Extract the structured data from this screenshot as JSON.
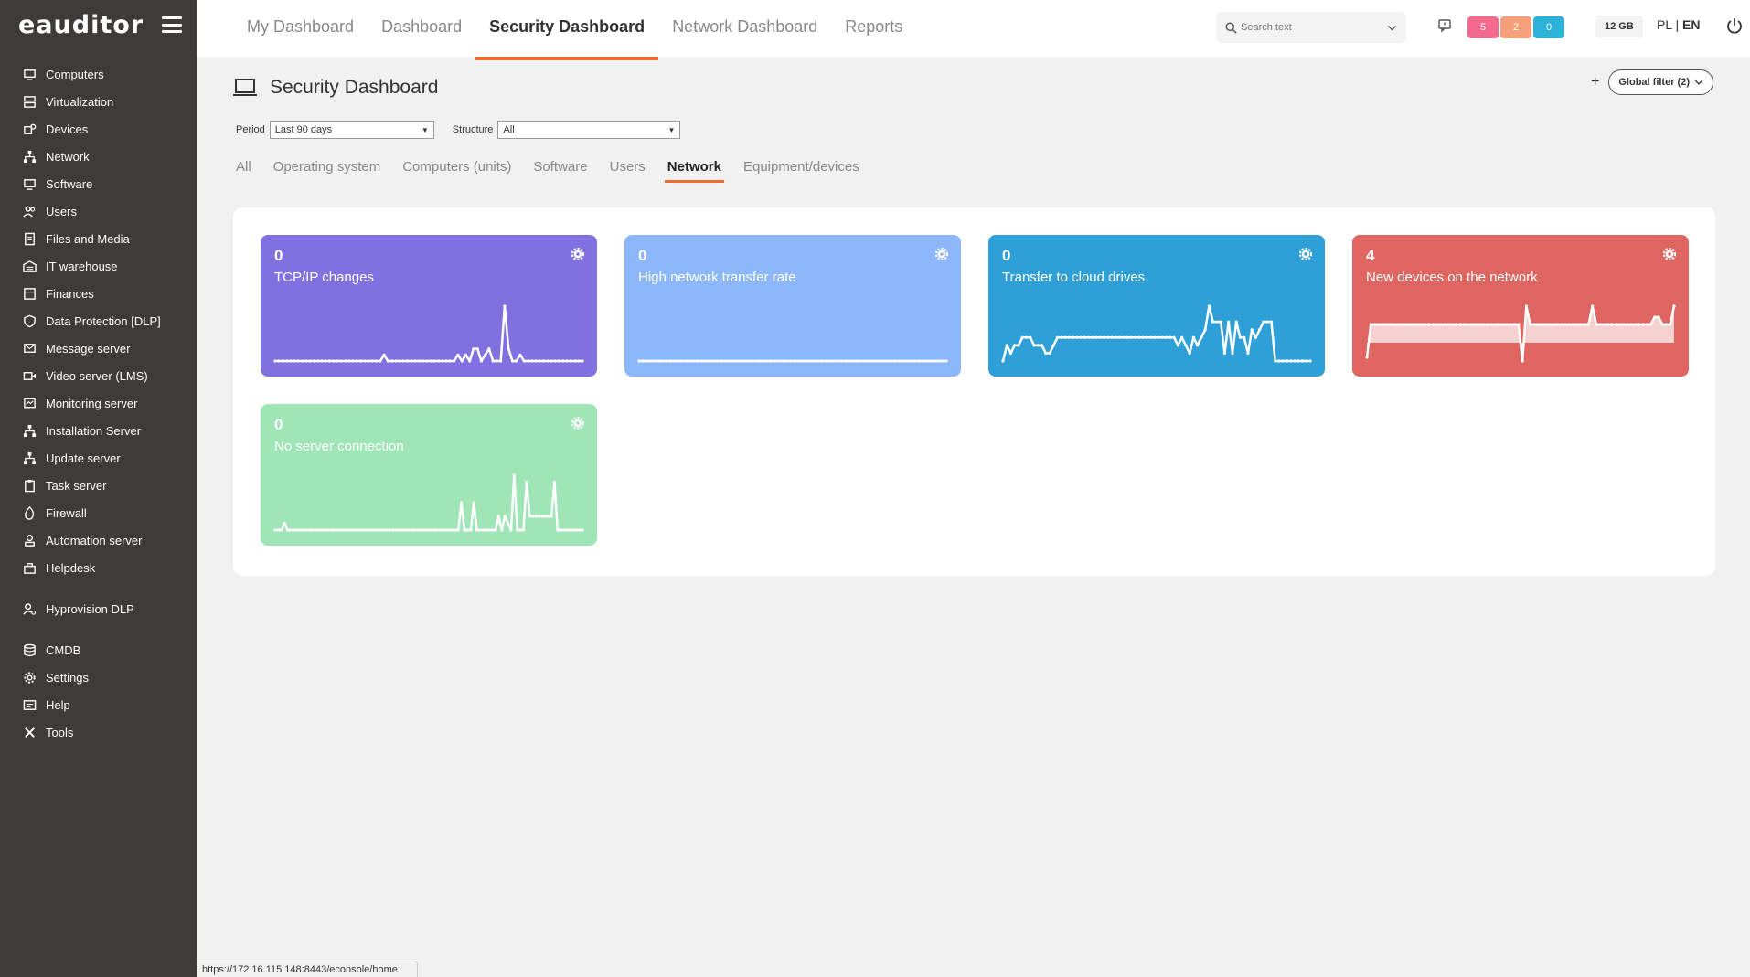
{
  "app": {
    "logo": "eauditor"
  },
  "sidebar": {
    "items": [
      {
        "label": "Computers",
        "icon": "monitor-icon"
      },
      {
        "label": "Virtualization",
        "icon": "server-icon"
      },
      {
        "label": "Devices",
        "icon": "devices-icon"
      },
      {
        "label": "Network",
        "icon": "network-icon"
      },
      {
        "label": "Software",
        "icon": "monitor-icon"
      },
      {
        "label": "Users",
        "icon": "users-icon"
      },
      {
        "label": "Files and Media",
        "icon": "file-icon"
      },
      {
        "label": "IT warehouse",
        "icon": "warehouse-icon"
      },
      {
        "label": "Finances",
        "icon": "finance-icon"
      },
      {
        "label": "Data Protection [DLP]",
        "icon": "shield-icon"
      },
      {
        "label": "Message server",
        "icon": "message-icon"
      },
      {
        "label": "Video server (LMS)",
        "icon": "video-icon"
      },
      {
        "label": "Monitoring server",
        "icon": "monitoring-icon"
      },
      {
        "label": "Installation Server",
        "icon": "network-icon"
      },
      {
        "label": "Update server",
        "icon": "network-icon"
      },
      {
        "label": "Task server",
        "icon": "clipboard-icon"
      },
      {
        "label": "Firewall",
        "icon": "firewall-icon"
      },
      {
        "label": "Automation server",
        "icon": "automation-icon"
      },
      {
        "label": "Helpdesk",
        "icon": "helpdesk-icon"
      }
    ],
    "items2": [
      {
        "label": "Hyprovision DLP",
        "icon": "user-key-icon"
      }
    ],
    "items3": [
      {
        "label": "CMDB",
        "icon": "database-icon"
      },
      {
        "label": "Settings",
        "icon": "gear-icon"
      },
      {
        "label": "Help",
        "icon": "help-icon"
      },
      {
        "label": "Tools",
        "icon": "tools-icon"
      }
    ]
  },
  "topbar": {
    "tabs": [
      "My Dashboard",
      "Dashboard",
      "Security Dashboard",
      "Network Dashboard",
      "Reports"
    ],
    "active_tab": 2,
    "search_placeholder": "Search text",
    "badges": [
      {
        "value": "5",
        "color": "#f36a8e"
      },
      {
        "value": "2",
        "color": "#f6a07b"
      },
      {
        "value": "0",
        "color": "#2bb3d9"
      }
    ],
    "memory": "12 GB",
    "lang_pl": "PL",
    "lang_sep": "|",
    "lang_en": "EN"
  },
  "page": {
    "title": "Security Dashboard",
    "global_filter": "Global filter (2)",
    "period_label": "Period",
    "period_value": "Last 90 days",
    "structure_label": "Structure",
    "structure_value": "All",
    "subtabs": [
      "All",
      "Operating system",
      "Computers (units)",
      "Software",
      "Users",
      "Network",
      "Equipment/devices"
    ],
    "active_subtab": 5
  },
  "cards": [
    {
      "value": "0",
      "label": "TCP/IP changes",
      "color": "#7f72e0",
      "series": [
        0,
        0,
        0,
        0,
        0,
        0,
        0,
        0,
        0,
        0,
        0,
        0,
        0,
        0,
        0,
        0,
        0,
        0,
        0,
        0,
        0,
        0,
        0,
        0,
        0,
        0,
        0,
        0,
        1,
        0,
        0,
        0,
        0,
        0,
        0,
        0,
        0,
        0,
        0,
        0,
        0,
        0,
        0,
        0,
        0,
        0,
        0,
        1,
        0,
        1,
        0,
        2,
        2,
        0,
        1,
        2,
        0,
        0,
        0,
        9,
        2,
        0,
        0,
        1,
        0,
        0,
        0,
        0,
        0,
        0,
        0,
        0,
        0,
        0,
        0,
        0,
        0,
        0,
        0,
        0
      ],
      "fill": false
    },
    {
      "value": "0",
      "label": "High network transfer rate",
      "color": "#8cb8fb",
      "series": [
        0,
        0,
        0,
        0,
        0,
        0,
        0,
        0,
        0,
        0,
        0,
        0,
        0,
        0,
        0,
        0,
        0,
        0,
        0,
        0,
        0,
        0,
        0,
        0,
        0,
        0,
        0,
        0,
        0,
        0,
        0,
        0,
        0,
        0,
        0,
        0,
        0,
        0,
        0,
        0,
        0,
        0,
        0,
        0,
        0,
        0,
        0,
        0,
        0,
        0,
        0,
        0,
        0,
        0,
        0,
        0,
        0,
        0,
        0,
        0,
        0,
        0,
        0,
        0,
        0,
        0,
        0,
        0,
        0,
        0,
        0,
        0,
        0,
        0,
        0,
        0,
        0,
        0,
        0,
        0
      ],
      "fill": false
    },
    {
      "value": "0",
      "label": "Transfer to cloud drives",
      "color": "#2f9fd8",
      "series": [
        0,
        2,
        1,
        2,
        2,
        3,
        3,
        3,
        2,
        2,
        2,
        1,
        1,
        2,
        3,
        3,
        3,
        3,
        3,
        3,
        3,
        3,
        3,
        3,
        3,
        3,
        3,
        3,
        3,
        3,
        3,
        3,
        3,
        3,
        3,
        3,
        3,
        3,
        3,
        3,
        3,
        3,
        3,
        3,
        3,
        2,
        3,
        2,
        1,
        3,
        2,
        3,
        4,
        7,
        5,
        5,
        5,
        1,
        5,
        1,
        5,
        3,
        3,
        1,
        4,
        3,
        4,
        5,
        5,
        5,
        0,
        0,
        0,
        0,
        0,
        0,
        0,
        0,
        0,
        0
      ],
      "fill": false
    },
    {
      "value": "4",
      "label": "New devices on the network",
      "color": "#de6560",
      "series": [
        -4,
        5,
        5,
        5,
        5,
        5,
        5,
        5,
        5,
        5,
        5,
        5,
        5,
        5,
        5,
        5,
        5,
        5,
        5,
        5,
        5,
        5,
        5,
        5,
        5,
        5,
        5,
        5,
        5,
        5,
        5,
        5,
        5,
        5,
        5,
        5,
        5,
        5,
        5,
        5,
        -5,
        10,
        5,
        5,
        5,
        5,
        5,
        5,
        5,
        5,
        5,
        5,
        5,
        5,
        5,
        5,
        5,
        5,
        10,
        5,
        5,
        5,
        5,
        5,
        5,
        5,
        5,
        5,
        5,
        5,
        5,
        5,
        5,
        5,
        7,
        7,
        5,
        5,
        5,
        10
      ],
      "fill": true
    },
    {
      "value": "0",
      "label": "No server connection",
      "color": "#9fe5b6",
      "series": [
        0,
        0,
        0,
        1,
        0,
        0,
        0,
        0,
        0,
        0,
        0,
        0,
        0,
        0,
        0,
        0,
        0,
        0,
        0,
        0,
        0,
        0,
        0,
        0,
        0,
        0,
        0,
        0,
        0,
        0,
        0,
        0,
        0,
        0,
        0,
        0,
        0,
        0,
        0,
        0,
        0,
        0,
        0,
        0,
        0,
        0,
        0,
        0,
        0,
        0,
        0,
        0,
        0,
        0,
        0,
        0,
        0,
        0,
        0,
        0,
        4,
        0,
        0,
        0,
        4,
        0,
        0,
        0,
        0,
        0,
        0,
        0,
        2,
        0,
        2,
        1,
        0,
        8,
        0,
        0,
        0,
        7,
        2,
        2,
        2,
        2,
        2,
        2,
        2,
        2,
        7,
        0,
        0,
        0,
        0,
        0,
        0,
        0,
        0,
        0
      ],
      "fill": false
    }
  ],
  "statusbar": {
    "url": "https://172.16.115.148:8443/econsole/home"
  }
}
